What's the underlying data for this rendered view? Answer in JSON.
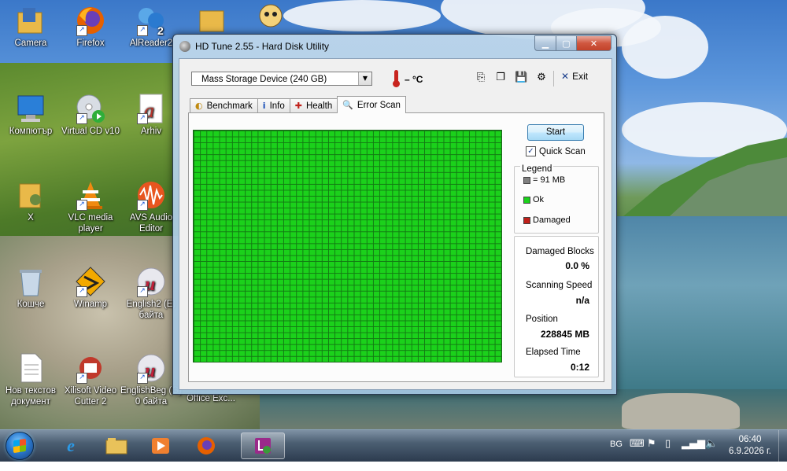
{
  "desktop": {
    "icons": [
      {
        "label": "Camera",
        "icon": "folder-camera-icon"
      },
      {
        "label": "Firefox",
        "icon": "firefox-icon"
      },
      {
        "label": "AlReader2",
        "icon": "alreader-icon"
      },
      {
        "label": "Компютър",
        "icon": "computer-icon"
      },
      {
        "label": "Virtual CD v10",
        "icon": "virtual-cd-icon"
      },
      {
        "label": "Arhiv",
        "icon": "arhiv-icon"
      },
      {
        "label": "X",
        "icon": "folder-user-icon"
      },
      {
        "label": "VLC media player",
        "icon": "vlc-icon"
      },
      {
        "label": "AVS Audio Editor",
        "icon": "avs-audio-icon"
      },
      {
        "label": "Кошче",
        "icon": "recycle-bin-icon"
      },
      {
        "label": "Winamp",
        "icon": "winamp-icon"
      },
      {
        "label": "English2 (E) байта",
        "icon": "english-icon"
      },
      {
        "label": "Нов текстов документ",
        "icon": "text-document-icon"
      },
      {
        "label": "Xilisoft Video Cutter 2",
        "icon": "xilisoft-icon"
      },
      {
        "label": "EnglishBeg (G) 0 байта",
        "icon": "english-icon"
      },
      {
        "label": "Microsoft Office Exc...",
        "icon": "office-icon"
      }
    ]
  },
  "window": {
    "title": "HD Tune 2.55 - Hard Disk Utility",
    "device": "Mass Storage Device (240 GB)",
    "temperature": "– °C",
    "exit_label": "Exit",
    "toolbar_icons": [
      "copy-icon",
      "copy-screenshot-icon",
      "save-icon",
      "options-icon"
    ],
    "tabs": [
      {
        "label": "Benchmark",
        "icon": "benchmark-icon"
      },
      {
        "label": "Info",
        "icon": "info-icon"
      },
      {
        "label": "Health",
        "icon": "health-cross-icon"
      },
      {
        "label": "Error Scan",
        "icon": "magnifier-icon",
        "active": true
      }
    ],
    "error_scan": {
      "start_label": "Start",
      "quick_scan_label": "Quick Scan",
      "quick_scan_checked": true,
      "legend_title": "Legend",
      "legend": [
        {
          "label": "= 91 MB",
          "color": "#808080"
        },
        {
          "label": "Ok",
          "color": "#1bd11b"
        },
        {
          "label": "Damaged",
          "color": "#c0201a"
        }
      ],
      "stats": [
        {
          "label": "Damaged Blocks",
          "value": "0.0 %"
        },
        {
          "label": "Scanning Speed",
          "value": "n/a"
        },
        {
          "label": "Position",
          "value": "228845 MB"
        },
        {
          "label": "Elapsed Time",
          "value": "0:12"
        }
      ],
      "grid_color": "#1bd11b"
    }
  },
  "taskbar": {
    "apps": [
      "internet-explorer-icon",
      "explorer-folder-icon",
      "media-player-icon",
      "firefox-icon",
      "hd-tune-icon"
    ],
    "language": "BG",
    "time": "06:40",
    "date": "6.9.2026 г."
  }
}
